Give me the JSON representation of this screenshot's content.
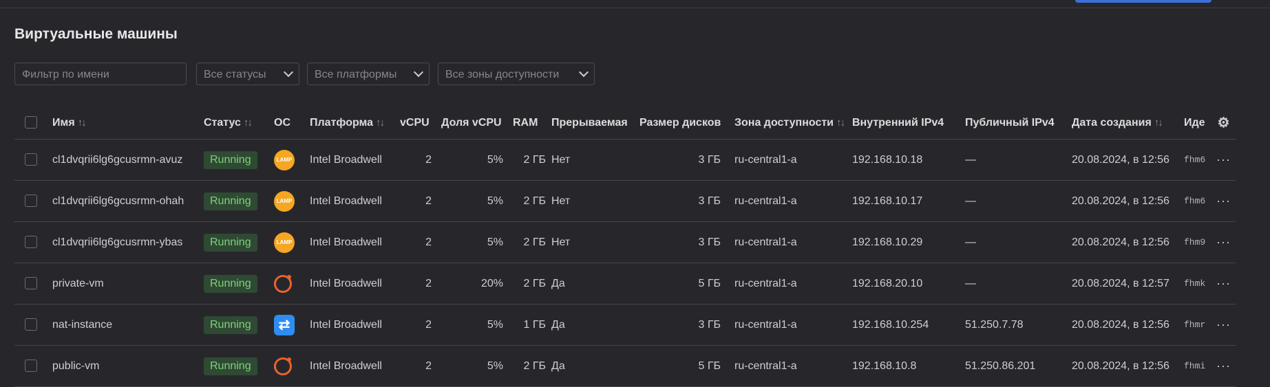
{
  "page": {
    "title": "Виртуальные машины"
  },
  "filters": {
    "name_placeholder": "Фильтр по имени",
    "status": "Все статусы",
    "platform": "Все платформы",
    "zone": "Все зоны доступности"
  },
  "columns": {
    "name": "Имя",
    "status": "Статус",
    "os": "ОС",
    "platform": "Платформа",
    "vcpu": "vCPU",
    "vcpu_share": "Доля vCPU",
    "ram": "RAM",
    "preemptible": "Прерываемая",
    "disk_size": "Размер дисков",
    "zone": "Зона доступности",
    "internal_ip": "Внутренний IPv4",
    "public_ip": "Публичный IPv4",
    "created": "Дата создания",
    "id": "Иде"
  },
  "sort_icon": "↑↓",
  "rows": [
    {
      "name": "cl1dvqrii6lg6gcusrmn-avuz",
      "status": "Running",
      "os": "lamp",
      "os_label": "LAMP",
      "platform": "Intel Broadwell",
      "vcpu": "2",
      "vcpu_share": "5%",
      "ram": "2 ГБ",
      "preemptible": "Нет",
      "disk": "3 ГБ",
      "zone": "ru-central1-a",
      "internal_ip": "192.168.10.18",
      "public_ip": "—",
      "created": "20.08.2024, в 12:56",
      "id": "fhm6"
    },
    {
      "name": "cl1dvqrii6lg6gcusrmn-ohah",
      "status": "Running",
      "os": "lamp",
      "os_label": "LAMP",
      "platform": "Intel Broadwell",
      "vcpu": "2",
      "vcpu_share": "5%",
      "ram": "2 ГБ",
      "preemptible": "Нет",
      "disk": "3 ГБ",
      "zone": "ru-central1-a",
      "internal_ip": "192.168.10.17",
      "public_ip": "—",
      "created": "20.08.2024, в 12:56",
      "id": "fhm6"
    },
    {
      "name": "cl1dvqrii6lg6gcusrmn-ybas",
      "status": "Running",
      "os": "lamp",
      "os_label": "LAMP",
      "platform": "Intel Broadwell",
      "vcpu": "2",
      "vcpu_share": "5%",
      "ram": "2 ГБ",
      "preemptible": "Нет",
      "disk": "3 ГБ",
      "zone": "ru-central1-a",
      "internal_ip": "192.168.10.29",
      "public_ip": "—",
      "created": "20.08.2024, в 12:56",
      "id": "fhm9"
    },
    {
      "name": "private-vm",
      "status": "Running",
      "os": "ubuntu",
      "os_label": "",
      "platform": "Intel Broadwell",
      "vcpu": "2",
      "vcpu_share": "20%",
      "ram": "2 ГБ",
      "preemptible": "Да",
      "disk": "5 ГБ",
      "zone": "ru-central1-a",
      "internal_ip": "192.168.20.10",
      "public_ip": "—",
      "created": "20.08.2024, в 12:57",
      "id": "fhmk"
    },
    {
      "name": "nat-instance",
      "status": "Running",
      "os": "nat",
      "os_label": "⇄",
      "platform": "Intel Broadwell",
      "vcpu": "2",
      "vcpu_share": "5%",
      "ram": "1 ГБ",
      "preemptible": "Да",
      "disk": "3 ГБ",
      "zone": "ru-central1-a",
      "internal_ip": "192.168.10.254",
      "public_ip": "51.250.7.78",
      "created": "20.08.2024, в 12:56",
      "id": "fhmr"
    },
    {
      "name": "public-vm",
      "status": "Running",
      "os": "ubuntu",
      "os_label": "",
      "platform": "Intel Broadwell",
      "vcpu": "2",
      "vcpu_share": "5%",
      "ram": "2 ГБ",
      "preemptible": "Да",
      "disk": "5 ГБ",
      "zone": "ru-central1-a",
      "internal_ip": "192.168.10.8",
      "public_ip": "51.250.86.201",
      "created": "20.08.2024, в 12:56",
      "id": "fhmi"
    }
  ],
  "colors": {
    "status_bg": "#2f4a32",
    "status_fg": "#7fd07f",
    "lamp": "#f5a623",
    "ubuntu": "#e8622c",
    "nat": "#2f8cf0"
  }
}
